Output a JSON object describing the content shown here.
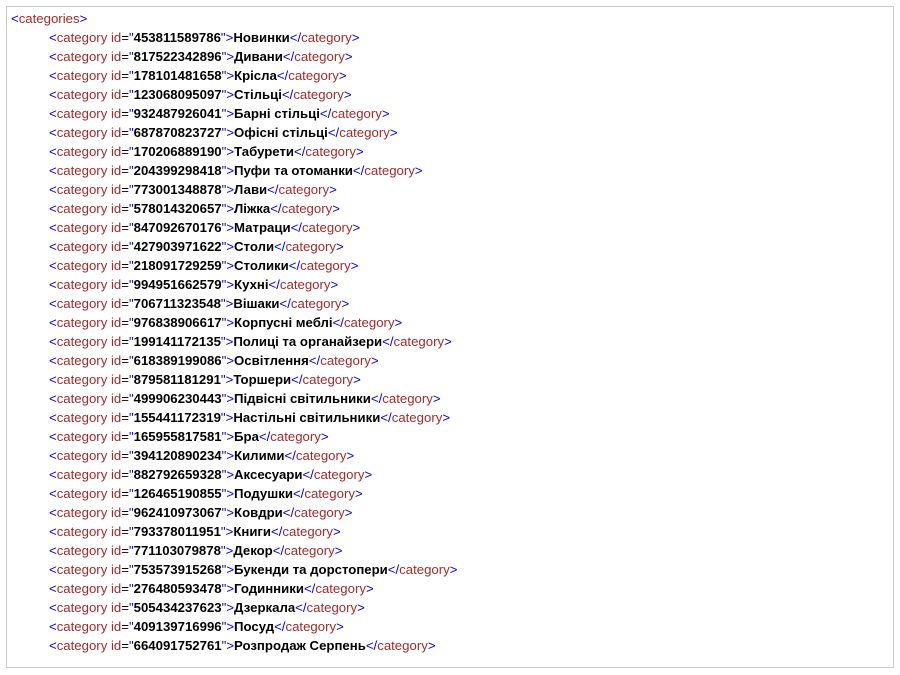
{
  "root_tag": "categories",
  "child_tag": "category",
  "attr_name": "id",
  "items": [
    {
      "id": "453811589786",
      "name": "Новинки"
    },
    {
      "id": "817522342896",
      "name": "Дивани"
    },
    {
      "id": "178101481658",
      "name": "Крісла"
    },
    {
      "id": "123068095097",
      "name": "Стільці"
    },
    {
      "id": "932487926041",
      "name": "Барні стільці"
    },
    {
      "id": "687870823727",
      "name": "Офісні стільці"
    },
    {
      "id": "170206889190",
      "name": "Табурети"
    },
    {
      "id": "204399298418",
      "name": "Пуфи та отоманки"
    },
    {
      "id": "773001348878",
      "name": "Лави"
    },
    {
      "id": "578014320657",
      "name": "Ліжка"
    },
    {
      "id": "847092670176",
      "name": "Матраци"
    },
    {
      "id": "427903971622",
      "name": "Столи"
    },
    {
      "id": "218091729259",
      "name": "Столики"
    },
    {
      "id": "994951662579",
      "name": "Кухні"
    },
    {
      "id": "706711323548",
      "name": "Вішаки"
    },
    {
      "id": "976838906617",
      "name": "Корпусні меблі"
    },
    {
      "id": "199141172135",
      "name": "Полиці та органайзери"
    },
    {
      "id": "618389199086",
      "name": "Освітлення"
    },
    {
      "id": "879581181291",
      "name": "Торшери"
    },
    {
      "id": "499906230443",
      "name": "Підвісні світильники"
    },
    {
      "id": "155441172319",
      "name": "Настільні світильники"
    },
    {
      "id": "165955817581",
      "name": "Бра"
    },
    {
      "id": "394120890234",
      "name": "Килими"
    },
    {
      "id": "882792659328",
      "name": "Аксесуари"
    },
    {
      "id": "126465190855",
      "name": "Подушки"
    },
    {
      "id": "962410973067",
      "name": "Ковдри"
    },
    {
      "id": "793378011951",
      "name": "Книги"
    },
    {
      "id": "771103079878",
      "name": "Декор"
    },
    {
      "id": "753573915268",
      "name": "Букенди та дорстопери"
    },
    {
      "id": "276480593478",
      "name": "Годинники"
    },
    {
      "id": "505434237623",
      "name": "Дзеркала"
    },
    {
      "id": "409139716996",
      "name": "Посуд"
    },
    {
      "id": "664091752761",
      "name": "Розпродаж Серпень"
    }
  ]
}
